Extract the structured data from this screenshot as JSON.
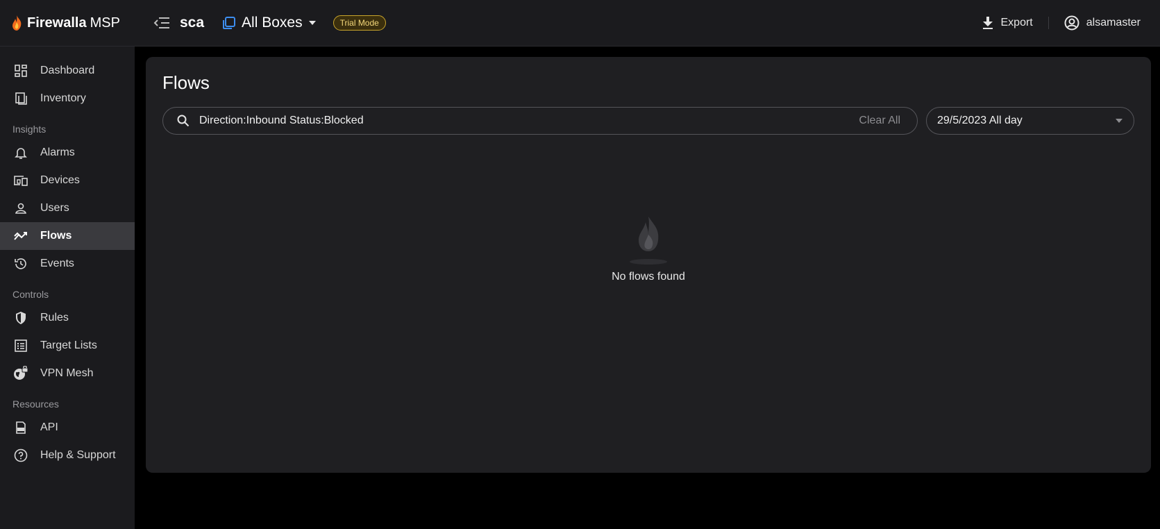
{
  "header": {
    "brand_name": "Firewalla",
    "brand_suffix": "MSP",
    "org_name": "sca",
    "box_selector": "All Boxes",
    "trial_badge": "Trial Mode",
    "export_label": "Export",
    "username": "alsamaster"
  },
  "sidebar": {
    "items_top": [
      {
        "label": "Dashboard",
        "icon": "dashboard-icon"
      },
      {
        "label": "Inventory",
        "icon": "inventory-icon"
      }
    ],
    "sections": {
      "insights": "Insights",
      "controls": "Controls",
      "resources": "Resources"
    },
    "insights_items": [
      {
        "label": "Alarms",
        "icon": "bell-icon"
      },
      {
        "label": "Devices",
        "icon": "devices-icon"
      },
      {
        "label": "Users",
        "icon": "user-icon"
      },
      {
        "label": "Flows",
        "icon": "flows-icon",
        "active": true
      },
      {
        "label": "Events",
        "icon": "history-icon"
      }
    ],
    "controls_items": [
      {
        "label": "Rules",
        "icon": "shield-icon"
      },
      {
        "label": "Target Lists",
        "icon": "list-icon"
      },
      {
        "label": "VPN Mesh",
        "icon": "globe-lock-icon"
      }
    ],
    "resources_items": [
      {
        "label": "API",
        "icon": "api-icon"
      },
      {
        "label": "Help & Support",
        "icon": "help-icon"
      }
    ]
  },
  "main": {
    "title": "Flows",
    "search_query": "Direction:Inbound Status:Blocked",
    "clear_label": "Clear All",
    "date_value": "29/5/2023 All day",
    "empty_text": "No flows found"
  },
  "colors": {
    "background": "#000000",
    "panel": "#1b1b1e",
    "card": "#1f1f22",
    "active_nav": "#3a3a3e",
    "trial_badge": "#c9a52c",
    "box_icon": "#3d8ef0",
    "brand_flame": "#f26b1d"
  }
}
